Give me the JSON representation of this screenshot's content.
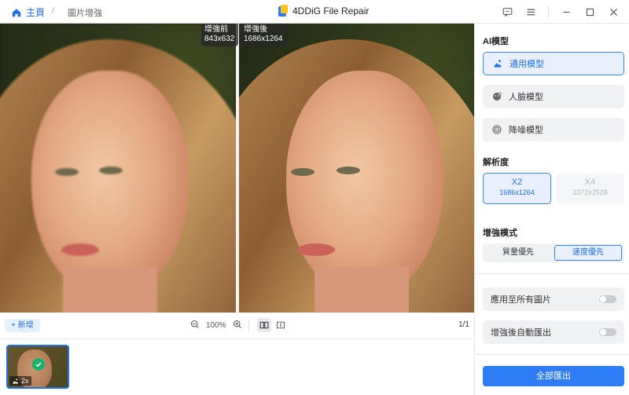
{
  "titlebar": {
    "home_label": "主頁",
    "breadcrumb_sep": "/",
    "breadcrumb_current": "圖片增強",
    "app_title": "4DDiG File Repair"
  },
  "preview": {
    "before_label": "增強前",
    "before_size": "843x632",
    "after_label": "增強後",
    "after_size": "1686x1264"
  },
  "toolbar": {
    "add_label": "+ 新增",
    "zoom_value": "100%",
    "page_indicator": "1/1"
  },
  "thumbnail": {
    "scale_label": "2x"
  },
  "panel": {
    "ai_model_title": "AI模型",
    "models": [
      {
        "label": "通用模型",
        "icon": "landscape-icon",
        "selected": true
      },
      {
        "label": "人臉模型",
        "icon": "face-icon",
        "selected": false
      },
      {
        "label": "降噪模型",
        "icon": "denoise-icon",
        "selected": false
      }
    ],
    "resolution_title": "解析度",
    "resolutions": [
      {
        "label": "X2",
        "size": "1686x1264",
        "selected": true
      },
      {
        "label": "X4",
        "size": "3372x2528",
        "selected": false
      }
    ],
    "mode_title": "增強模式",
    "modes": [
      {
        "label": "質量優先",
        "selected": false
      },
      {
        "label": "速度優先",
        "selected": true
      }
    ],
    "apply_all_label": "應用至所有圖片",
    "auto_export_label": "增強後自動匯出",
    "export_label": "全部匯出"
  },
  "colors": {
    "accent": "#2f7df6",
    "accent_text": "#1f6fe5",
    "selected_bg": "#e8f0fd",
    "check": "#18b26b"
  }
}
